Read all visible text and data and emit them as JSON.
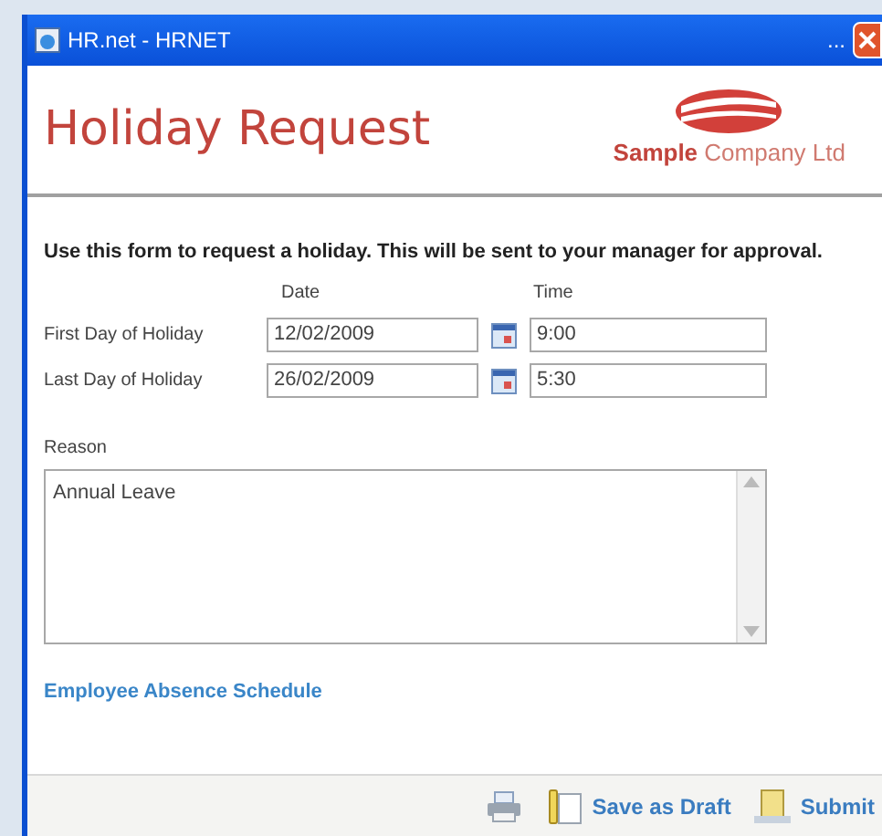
{
  "window": {
    "title": "HR.net - HRNET",
    "title_extra": "..."
  },
  "header": {
    "title": "Holiday Request",
    "logo_bold": "Sample",
    "logo_rest": "Company Ltd"
  },
  "intro": "Use this form to request a holiday. This will be sent to your manager for approval.",
  "columns": [
    "Date",
    "Time"
  ],
  "rows": [
    {
      "label": "First Day of Holiday",
      "date": "12/02/2009",
      "time": "9:00"
    },
    {
      "label": "Last Day of Holiday",
      "date": "26/02/2009",
      "time": "5:30"
    }
  ],
  "reason": {
    "label": "Reason",
    "value": "Annual Leave"
  },
  "link": "Employee Absence Schedule",
  "footer": {
    "buttons": [
      {
        "kind": "print"
      },
      {
        "kind": "draft",
        "label": "Save as Draft"
      },
      {
        "kind": "submit",
        "label": "Submit"
      }
    ]
  }
}
